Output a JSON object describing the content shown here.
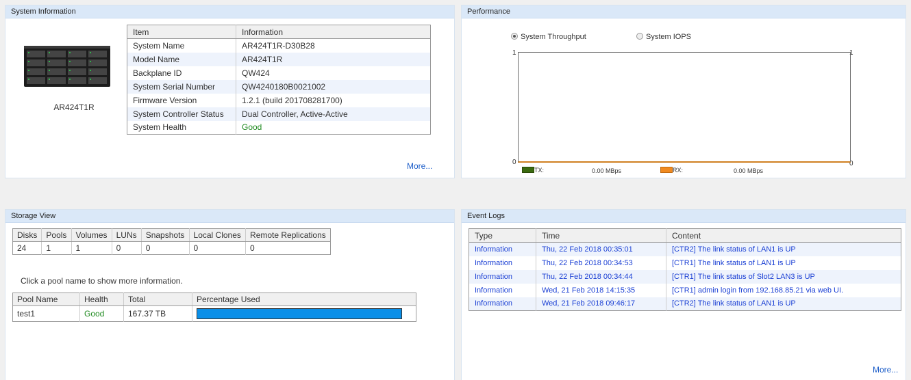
{
  "system_info": {
    "title": "System Information",
    "device_label": "AR424T1R",
    "table_headers": [
      "Item",
      "Information"
    ],
    "rows": [
      {
        "item": "System Name",
        "value": "AR424T1R-D30B28"
      },
      {
        "item": "Model Name",
        "value": "AR424T1R"
      },
      {
        "item": "Backplane ID",
        "value": "QW424"
      },
      {
        "item": "System Serial Number",
        "value": "QW4240180B0021002"
      },
      {
        "item": "Firmware Version",
        "value": "1.2.1 (build 201708281700)"
      },
      {
        "item": "System Controller Status",
        "value": "Dual Controller, Active-Active"
      },
      {
        "item": "System Health",
        "value": "Good"
      }
    ],
    "more": "More..."
  },
  "performance": {
    "title": "Performance",
    "radio_throughput": "System Throughput",
    "radio_iops": "System IOPS",
    "selected": "throughput",
    "y_max_left": "1",
    "y_max_right": "1",
    "y_min_left": "0",
    "y_min_right": "0",
    "tx_label": "TX:",
    "tx_value": "0.00 MBps",
    "rx_label": "RX:",
    "rx_value": "0.00 MBps",
    "tx_color": "#3a6a10",
    "rx_color": "#f08a20"
  },
  "storage": {
    "title": "Storage View",
    "summary_headers": [
      "Disks",
      "Pools",
      "Volumes",
      "LUNs",
      "Snapshots",
      "Local Clones",
      "Remote Replications"
    ],
    "summary_values": [
      "24",
      "1",
      "1",
      "0",
      "0",
      "0",
      "0"
    ],
    "hint": "Click a pool name to show more information.",
    "pool_headers": [
      "Pool Name",
      "Health",
      "Total",
      "Percentage Used"
    ],
    "pools": [
      {
        "name": "test1",
        "health": "Good",
        "total": "167.37 TB",
        "percent_used": 100
      }
    ],
    "bar_color": "#0a8fe8"
  },
  "events": {
    "title": "Event Logs",
    "headers": [
      "Type",
      "Time",
      "Content"
    ],
    "rows": [
      {
        "type": "Information",
        "time": "Thu, 22 Feb 2018 00:35:01",
        "content": "[CTR2] The link status of LAN1 is UP"
      },
      {
        "type": "Information",
        "time": "Thu, 22 Feb 2018 00:34:53",
        "content": "[CTR1] The link status of LAN1 is UP"
      },
      {
        "type": "Information",
        "time": "Thu, 22 Feb 2018 00:34:44",
        "content": "[CTR1] The link status of Slot2 LAN3 is UP"
      },
      {
        "type": "Information",
        "time": "Wed, 21 Feb 2018 14:15:35",
        "content": "[CTR1] admin login from 192.168.85.21 via web UI."
      },
      {
        "type": "Information",
        "time": "Wed, 21 Feb 2018 09:46:17",
        "content": "[CTR2] The link status of LAN1 is UP"
      }
    ],
    "more": "More..."
  }
}
